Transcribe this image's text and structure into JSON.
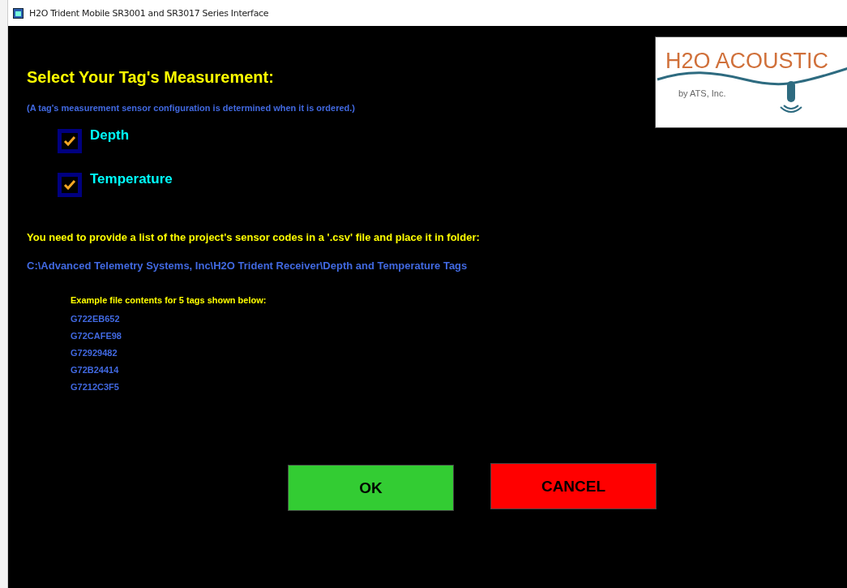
{
  "window": {
    "title": "H2O Trident Mobile SR3001 and SR3017 Series Interface"
  },
  "logo": {
    "name": "H2O ACOUSTIC",
    "tagline": "by ATS, Inc."
  },
  "heading": "Select Your Tag's Measurement:",
  "note": "(A tag's measurement sensor configuration is determined when it is ordered.)",
  "options": [
    {
      "label": "Depth",
      "checked": true
    },
    {
      "label": "Temperature",
      "checked": true
    }
  ],
  "instruction": "You need to provide a list of the project's sensor codes in a '.csv' file and place it in folder:",
  "folder_path": "C:\\Advanced Telemetry Systems, Inc\\H2O Trident Receiver\\Depth and Temperature Tags",
  "example": {
    "caption": "Example file contents for 5 tags shown below:",
    "codes": [
      "G722EB652",
      "G72CAFE98",
      "G72929482",
      "G72B24414",
      "G7212C3F5"
    ]
  },
  "buttons": [
    {
      "label": "OK",
      "kind": "ok"
    },
    {
      "label": "CANCEL",
      "kind": "cancel"
    }
  ]
}
